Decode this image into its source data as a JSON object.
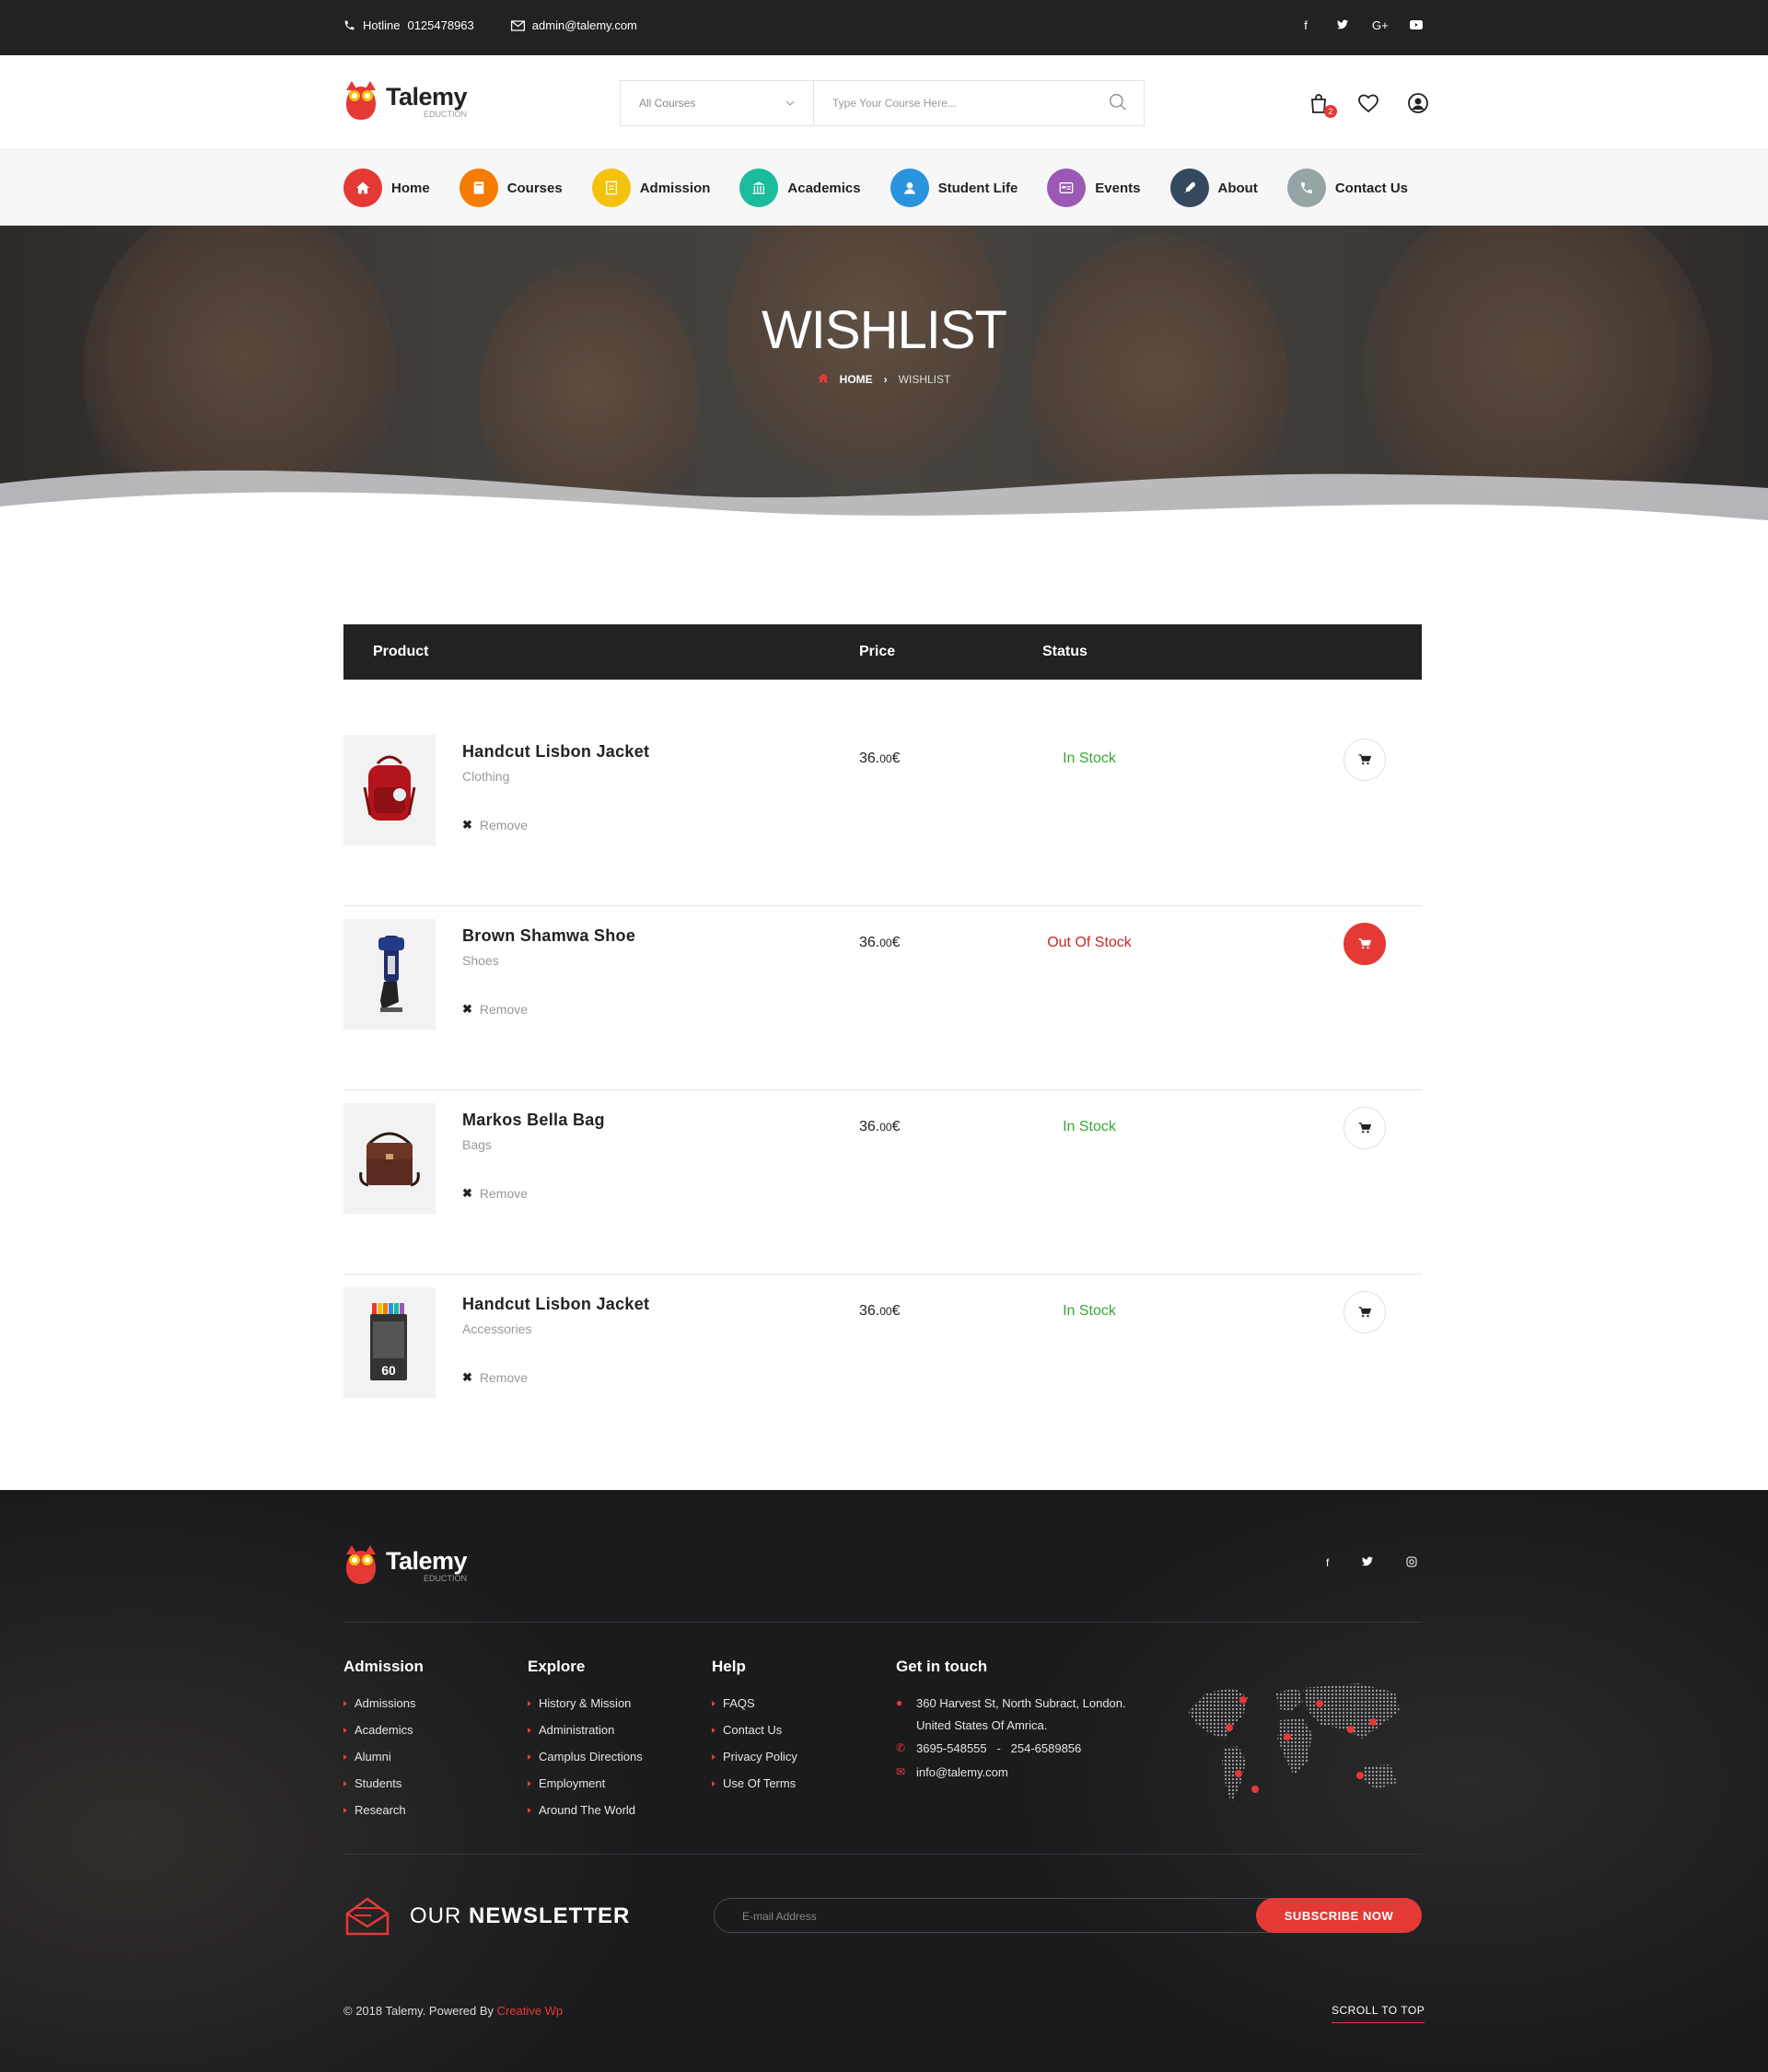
{
  "topbar": {
    "hotline_label": "Hotline",
    "hotline_number": "0125478963",
    "email": "admin@talemy.com",
    "social": [
      "f",
      "t",
      "G+",
      "yt"
    ]
  },
  "brand": {
    "name": "Talemy",
    "tagline": "EDUCTION"
  },
  "search": {
    "category": "All Courses",
    "placeholder": "Type Your Course Here...",
    "cart_count": "2"
  },
  "nav": {
    "items": [
      {
        "label": "Home",
        "color": "#e53935",
        "icon": "home-icon"
      },
      {
        "label": "Courses",
        "color": "#f57c00",
        "icon": "book-icon"
      },
      {
        "label": "Admission",
        "color": "#f4c20d",
        "icon": "form-icon"
      },
      {
        "label": "Academics",
        "color": "#1abc9c",
        "icon": "building-icon"
      },
      {
        "label": "Student Life",
        "color": "#2a93dd",
        "icon": "user-icon"
      },
      {
        "label": "Events",
        "color": "#9b59b6",
        "icon": "calendar-icon"
      },
      {
        "label": "About",
        "color": "#34495e",
        "icon": "pen-icon"
      },
      {
        "label": "Contact Us",
        "color": "#95a5a6",
        "icon": "phone-icon"
      }
    ]
  },
  "hero": {
    "title": "WISHLIST",
    "crumb_home": "HOME",
    "crumb_current": "WISHLIST"
  },
  "table": {
    "headers": {
      "product": "Product",
      "price": "Price",
      "status": "Status"
    },
    "rows": [
      {
        "name": "Handcut Lisbon Jacket",
        "category": "Clothing",
        "price_main": "36.",
        "price_dec": "00",
        "currency": "€",
        "status": "In Stock",
        "in_stock": true,
        "remove": "Remove",
        "thumb": "backpack-image"
      },
      {
        "name": "Brown Shamwa Shoe",
        "category": "Shoes",
        "price_main": "36.",
        "price_dec": "00",
        "currency": "€",
        "status": "Out Of Stock",
        "in_stock": false,
        "remove": "Remove",
        "thumb": "shoe-image"
      },
      {
        "name": "Markos Bella Bag",
        "category": "Bags",
        "price_main": "36.",
        "price_dec": "00",
        "currency": "€",
        "status": "In Stock",
        "in_stock": true,
        "remove": "Remove",
        "thumb": "bag-image"
      },
      {
        "name": "Handcut Lisbon Jacket",
        "category": "Accessories",
        "price_main": "36.",
        "price_dec": "00",
        "currency": "€",
        "status": "In Stock",
        "in_stock": true,
        "remove": "Remove",
        "thumb": "markers-image"
      }
    ],
    "colors": {
      "in_stock": "#3aa63a",
      "out_of_stock": "#c62828"
    }
  },
  "footer": {
    "social": [
      "f",
      "t",
      "ig"
    ],
    "columns": [
      {
        "title": "Admission",
        "links": [
          "Admissions",
          "Academics",
          "Alumni",
          "Students",
          "Research"
        ]
      },
      {
        "title": "Explore",
        "links": [
          "History & Mission",
          "Administration",
          "Camplus Directions",
          "Employment",
          "Around The World"
        ]
      },
      {
        "title": "Help",
        "links": [
          "FAQS",
          "Contact Us",
          "Privacy Policy",
          "Use Of Terms"
        ]
      }
    ],
    "contact": {
      "title": "Get in touch",
      "address_line1": "360 Harvest St, North Subract, London.",
      "address_line2": "United States Of Amrica.",
      "phones": "3695-548555   -   254-6589856",
      "email": "info@talemy.com"
    },
    "newsletter": {
      "title_light": "OUR",
      "title_bold": "NEWSLETTER",
      "placeholder": "E-mail Address",
      "button": "SUBSCRIBE NOW"
    },
    "copyright_prefix": "© 2018 Talemy.  Powered By",
    "copyright_brand": "Creative Wp",
    "scroll_top": "SCROLL TO TOP"
  }
}
